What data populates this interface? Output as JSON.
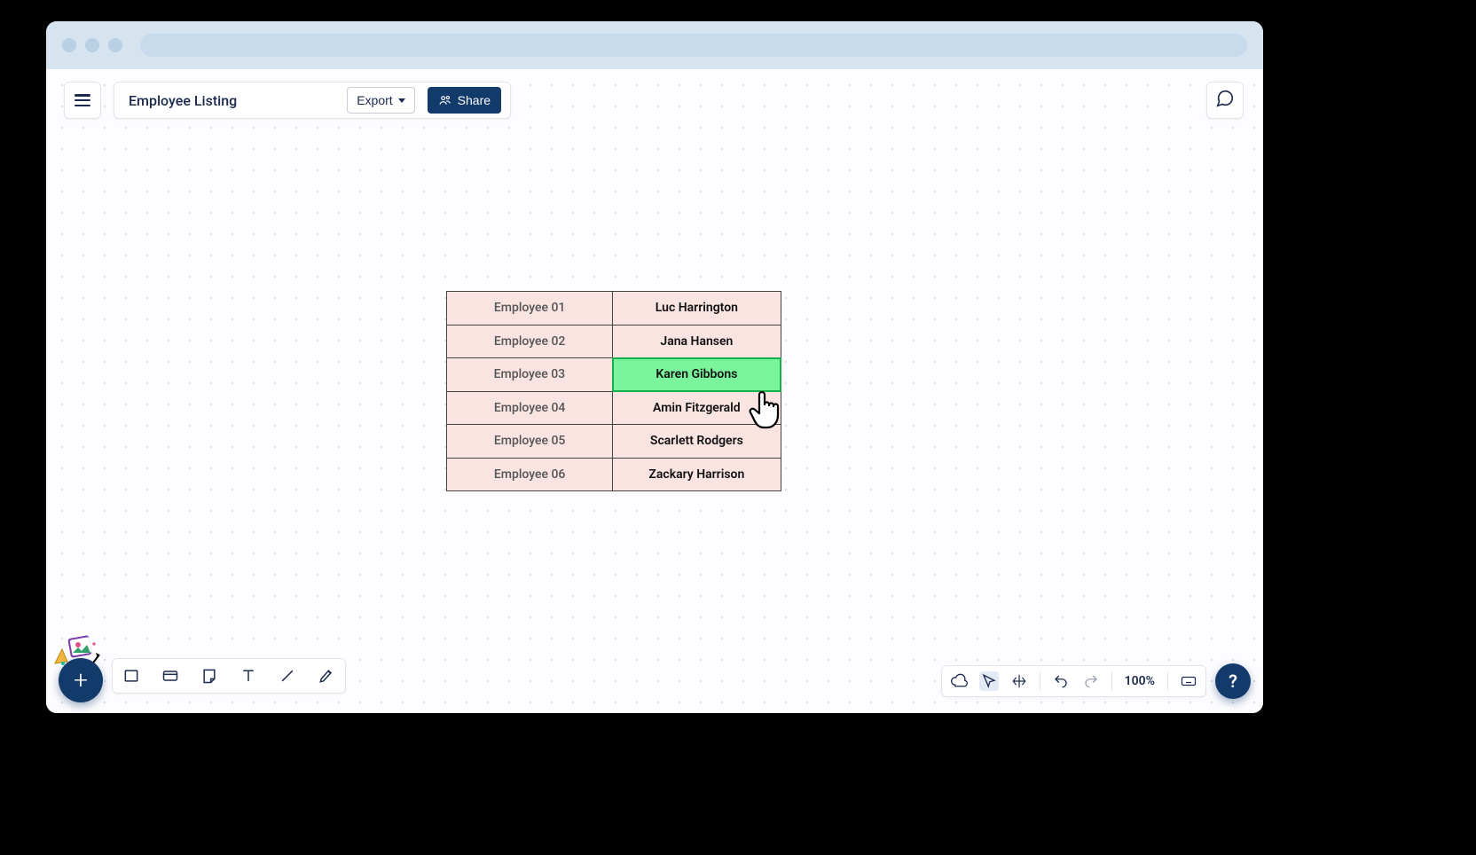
{
  "document": {
    "title": "Employee Listing"
  },
  "toolbar": {
    "export_label": "Export",
    "share_label": "Share"
  },
  "table": {
    "rows": [
      {
        "label": "Employee 01",
        "name": "Luc Harrington"
      },
      {
        "label": "Employee 02",
        "name": "Jana Hansen"
      },
      {
        "label": "Employee 03",
        "name": "Karen Gibbons"
      },
      {
        "label": "Employee 04",
        "name": "Amin Fitzgerald"
      },
      {
        "label": "Employee 05",
        "name": "Scarlett Rodgers"
      },
      {
        "label": "Employee 06",
        "name": "Zackary Harrison"
      }
    ],
    "highlighted_index": 2
  },
  "zoom": {
    "label": "100%"
  },
  "help": {
    "label": "?"
  }
}
